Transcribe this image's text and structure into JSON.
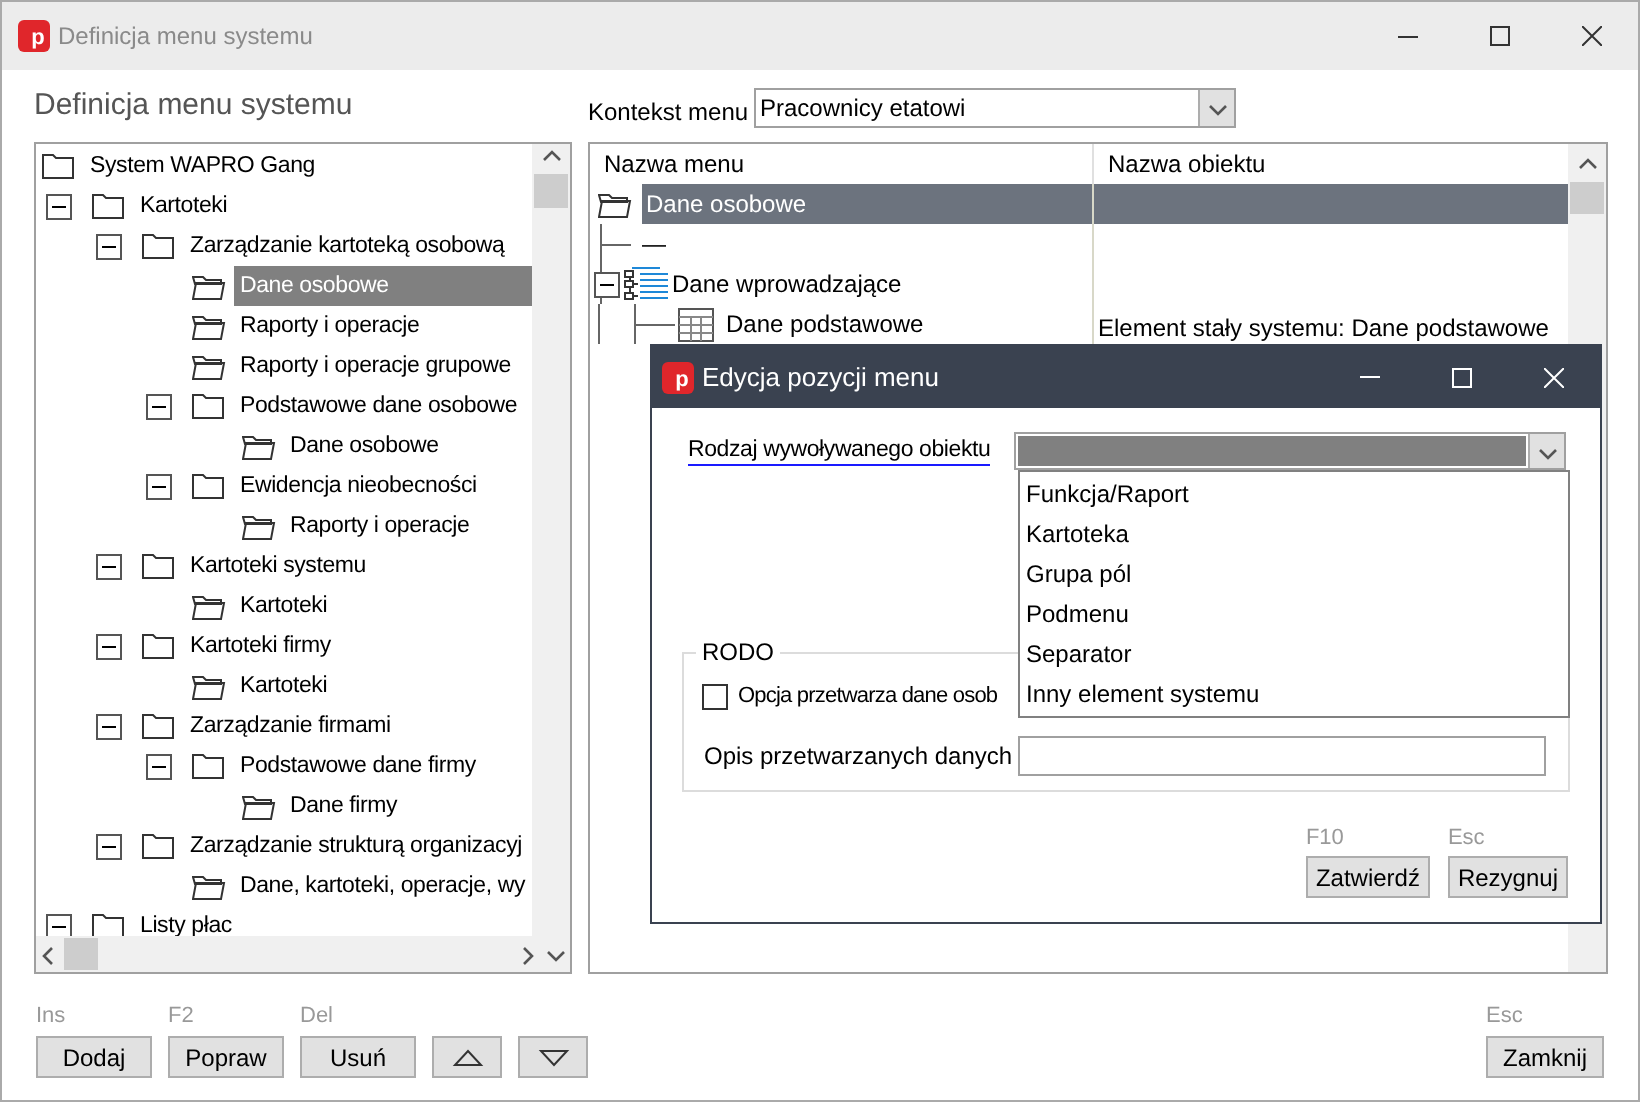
{
  "window": {
    "icon_text": "p",
    "title": "Definicja menu systemu"
  },
  "heading": "Definicja menu systemu",
  "tree": [
    {
      "label": "System WAPRO Gang",
      "selected": false,
      "children": [
        {
          "label": "Kartoteki",
          "selected": false,
          "expanded": true,
          "children": [
            {
              "label": "Zarządzanie kartoteką osobową",
              "selected": false,
              "expanded": true,
              "children": [
                {
                  "label": "Dane osobowe",
                  "selected": true
                },
                {
                  "label": "Raporty i operacje",
                  "selected": false
                },
                {
                  "label": "Raporty i operacje grupowe",
                  "selected": false
                },
                {
                  "label": "Podstawowe dane osobowe",
                  "selected": false,
                  "expanded": true,
                  "children": [
                    {
                      "label": "Dane osobowe",
                      "selected": false
                    }
                  ]
                },
                {
                  "label": "Ewidencja nieobecności",
                  "selected": false,
                  "expanded": true,
                  "children": [
                    {
                      "label": "Raporty i operacje",
                      "selected": false
                    }
                  ]
                }
              ]
            },
            {
              "label": "Kartoteki systemu",
              "selected": false,
              "expanded": true,
              "children": [
                {
                  "label": "Kartoteki",
                  "selected": false
                }
              ]
            },
            {
              "label": "Kartoteki firmy",
              "selected": false,
              "expanded": true,
              "children": [
                {
                  "label": "Kartoteki",
                  "selected": false
                }
              ]
            },
            {
              "label": "Zarządzanie firmami",
              "selected": false,
              "expanded": true,
              "children": [
                {
                  "label": "Podstawowe dane firmy",
                  "selected": false,
                  "expanded": true,
                  "children": [
                    {
                      "label": "Dane firmy",
                      "selected": false
                    }
                  ]
                }
              ]
            },
            {
              "label": "Zarządzanie strukturą organizacyj",
              "selected": false,
              "expanded": true,
              "children": [
                {
                  "label": "Dane, kartoteki, operacje, wy",
                  "selected": false
                }
              ]
            }
          ]
        },
        {
          "label": "Listy płac",
          "selected": false,
          "expanded": true
        }
      ]
    }
  ],
  "context": {
    "label": "Kontekst menu",
    "value": "Pracownicy etatowi"
  },
  "menu_table": {
    "columns": [
      "Nazwa menu",
      "Nazwa obiektu"
    ],
    "rows": [
      {
        "kind": "folder",
        "name": "Dane osobowe",
        "selected": true
      },
      {
        "kind": "separator",
        "name": "—",
        "selected": false
      },
      {
        "kind": "submenu",
        "name": "Dane wprowadzające",
        "expanded": true,
        "selected": false
      },
      {
        "kind": "table",
        "name": "Dane podstawowe",
        "object": "Element stały systemu: Dane podstawowe",
        "selected": false
      }
    ]
  },
  "footer": {
    "buttons": [
      {
        "kind": "text",
        "hotkey": "Ins",
        "label": "Dodaj"
      },
      {
        "kind": "text",
        "hotkey": "F2",
        "label": "Popraw"
      },
      {
        "kind": "text",
        "hotkey": "Del",
        "label": "Usuń"
      },
      {
        "kind": "up"
      },
      {
        "kind": "down"
      }
    ],
    "close": {
      "hotkey": "Esc",
      "label": "Zamknij"
    }
  },
  "dialog": {
    "icon_text": "p",
    "title": "Edycja pozycji menu",
    "object_type": {
      "label": "Rodzaj wywoływanego obiektu",
      "expanded": true,
      "options": [
        "Funkcja/Raport",
        "Kartoteka",
        "Grupa pól",
        "Podmenu",
        "Separator",
        "Inny element systemu"
      ]
    },
    "rodo": {
      "title": "RODO",
      "checkbox": {
        "label": "Opcja przetwarza dane osob",
        "checked": false
      },
      "description": {
        "label": "Opis przetwarzanych danych"
      }
    },
    "buttons": [
      {
        "hotkey": "F10",
        "label": "Zatwierdź"
      },
      {
        "hotkey": "Esc",
        "label": "Rezygnuj"
      }
    ]
  }
}
